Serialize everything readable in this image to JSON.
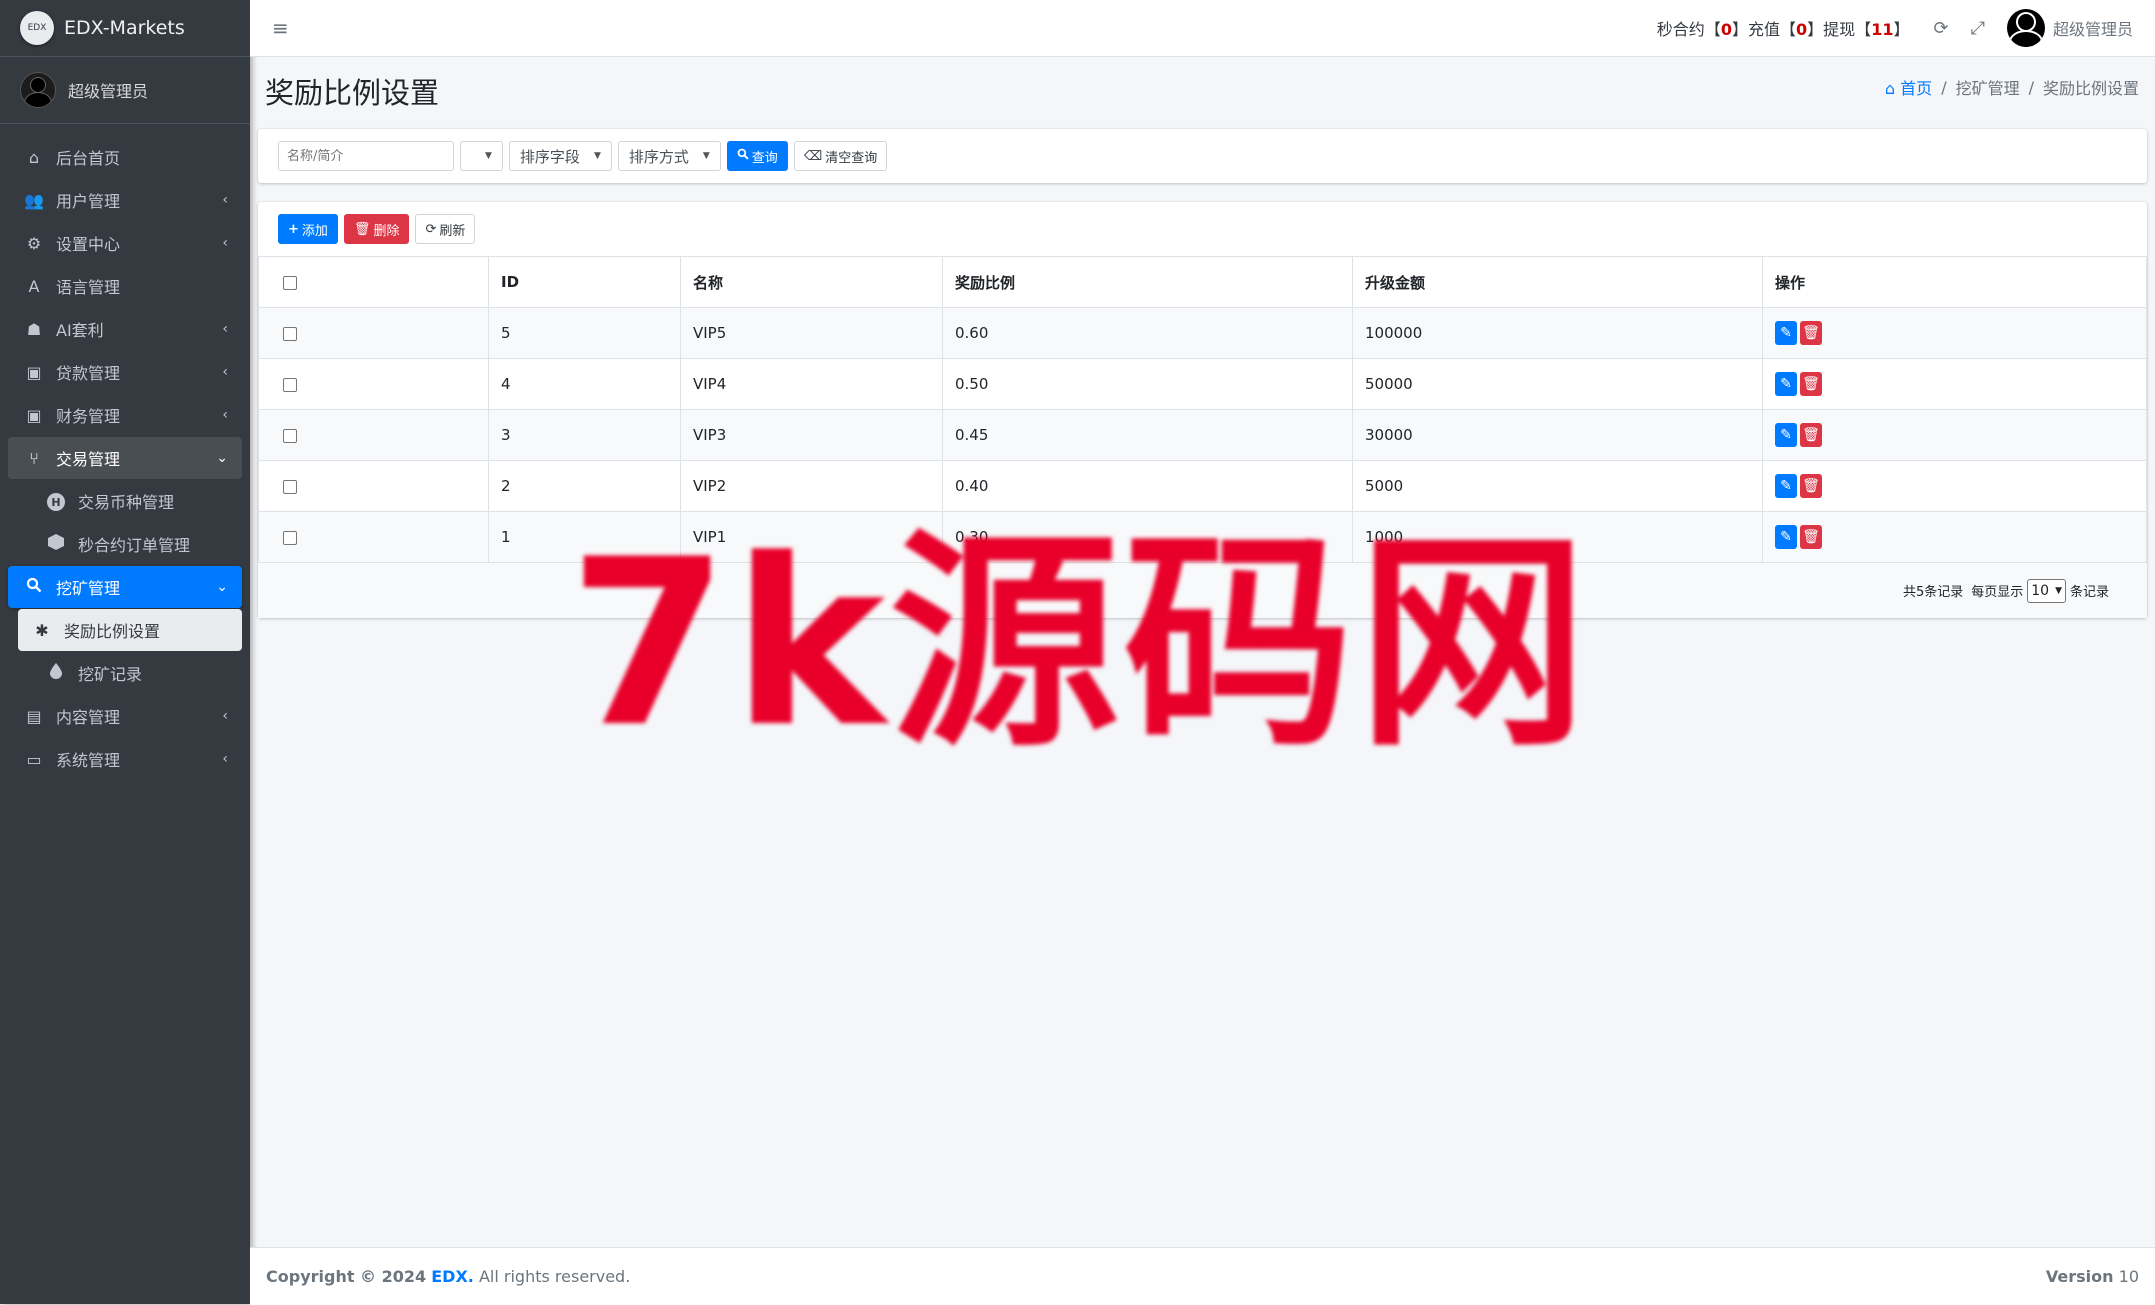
{
  "brand": {
    "logo_text": "EDX",
    "name": "EDX-Markets"
  },
  "sidebar": {
    "user": "超级管理员",
    "items": [
      {
        "icon": "home-icon",
        "glyph": "⌂",
        "label": "后台首页",
        "chevron": ""
      },
      {
        "icon": "users-icon",
        "glyph": "👥",
        "label": "用户管理",
        "chevron": "‹"
      },
      {
        "icon": "cogs-icon",
        "glyph": "⚙",
        "label": "设置中心",
        "chevron": "‹"
      },
      {
        "icon": "language-icon",
        "glyph": "A",
        "label": "语言管理",
        "chevron": ""
      },
      {
        "icon": "android-icon",
        "glyph": "☗",
        "label": "AI套利",
        "chevron": "‹"
      },
      {
        "icon": "money-icon",
        "glyph": "▣",
        "label": "贷款管理",
        "chevron": "‹"
      },
      {
        "icon": "money-icon",
        "glyph": "▣",
        "label": "财务管理",
        "chevron": "‹"
      },
      {
        "icon": "trade-icon",
        "glyph": "⑂",
        "label": "交易管理",
        "chevron": "⌄"
      },
      {
        "icon": "h-circle-icon",
        "glyph": "H",
        "label": "交易币种管理",
        "chevron": ""
      },
      {
        "icon": "hexagon-icon",
        "glyph": "",
        "label": "秒合约订单管理",
        "chevron": ""
      },
      {
        "icon": "search-icon",
        "glyph": "🔍",
        "label": "挖矿管理",
        "chevron": "⌄"
      },
      {
        "icon": "bug-icon",
        "glyph": "✱",
        "label": "奖励比例设置",
        "chevron": ""
      },
      {
        "icon": "drop-icon",
        "glyph": "💧",
        "label": "挖矿记录",
        "chevron": ""
      },
      {
        "icon": "content-icon",
        "glyph": "▤",
        "label": "内容管理",
        "chevron": "‹"
      },
      {
        "icon": "desktop-icon",
        "glyph": "▭",
        "label": "系统管理",
        "chevron": "‹"
      }
    ]
  },
  "topbar": {
    "stats": {
      "seconds_label": "秒合约",
      "seconds_count": "0",
      "recharge_label": "充值",
      "recharge_count": "0",
      "withdraw_label": "提现",
      "withdraw_count": "11"
    },
    "user": "超级管理员"
  },
  "page": {
    "title": "奖励比例设置",
    "breadcrumb": {
      "home": "首页",
      "parent": "挖矿管理",
      "current": "奖励比例设置"
    }
  },
  "filters": {
    "name_placeholder": "名称/简介",
    "select_blank": "",
    "sort_field": "排序字段",
    "sort_order": "排序方式",
    "search_btn": "查询",
    "clear_btn": "清空查询"
  },
  "toolbar": {
    "add": "添加",
    "delete": "删除",
    "refresh": "刷新"
  },
  "table": {
    "headers": [
      "ID",
      "名称",
      "奖励比例",
      "升级金额",
      "操作"
    ],
    "rows": [
      {
        "id": "5",
        "name": "VIP5",
        "ratio": "0.60",
        "amount": "100000"
      },
      {
        "id": "4",
        "name": "VIP4",
        "ratio": "0.50",
        "amount": "50000"
      },
      {
        "id": "3",
        "name": "VIP3",
        "ratio": "0.45",
        "amount": "30000"
      },
      {
        "id": "2",
        "name": "VIP2",
        "ratio": "0.40",
        "amount": "5000"
      },
      {
        "id": "1",
        "name": "VIP1",
        "ratio": "0.30",
        "amount": "1000"
      }
    ]
  },
  "pager": {
    "total": "共5条记录",
    "per_page_label": "每页显示",
    "per_page": "10",
    "suffix": "条记录"
  },
  "watermark": "7k源码网",
  "footer": {
    "copyright": "Copyright © 2024",
    "brand": "EDX.",
    "rights": "All rights reserved.",
    "version_label": "Version",
    "version": "10"
  },
  "colors": {
    "primary": "#007bff",
    "danger": "#dc3545",
    "sidebar": "#343a40",
    "watermark": "#e8002a"
  }
}
